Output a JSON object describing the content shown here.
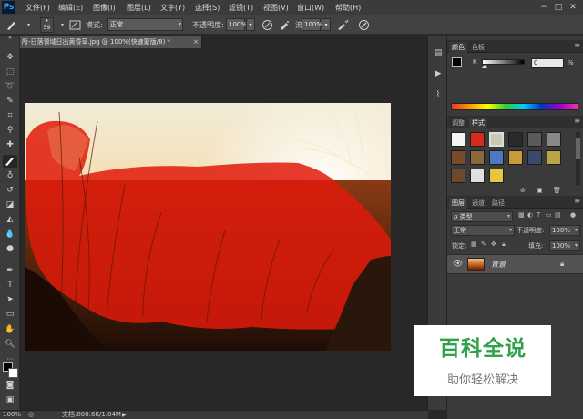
{
  "app": {
    "logo": "Ps"
  },
  "menu": {
    "items": [
      "文件(F)",
      "编辑(E)",
      "图像(I)",
      "图层(L)",
      "文字(Y)",
      "选择(S)",
      "滤镜(T)",
      "视图(V)",
      "窗口(W)",
      "帮助(H)"
    ]
  },
  "window_controls": {
    "minimize": "−",
    "maximize": "□",
    "close": "✕"
  },
  "options_bar": {
    "brush_size": "59",
    "mode_label": "模式:",
    "mode_value": "正常",
    "opacity_label": "不透明度:",
    "opacity_value": "100%",
    "flow_label": "流量:",
    "flow_value": "100%"
  },
  "document": {
    "tab_title": "所-日落领域日出黄昏草.jpg @ 100%(快速蒙版/8) *",
    "tab_close": "×"
  },
  "status": {
    "zoom": "100%",
    "doc_size": "文档:800.6K/1.04M"
  },
  "color_panel": {
    "tabs": [
      "颜色",
      "色板"
    ],
    "slider_label": "K",
    "value": "0",
    "unit": "%"
  },
  "styles_panel": {
    "tabs": [
      "调整",
      "样式"
    ],
    "swatch_colors": [
      "#f4f4f4",
      "#d92b1c",
      "#c9c9b2",
      "#2a2a2a",
      "#5a5a5a",
      "#888888",
      "#7a4a2a",
      "#8a6a3a",
      "#4a7ac0",
      "#c99a3a",
      "#3a4a6a",
      "#b9a44a",
      "#6a4a2a",
      "#e0e0e0",
      "#e6c640"
    ]
  },
  "layers_panel": {
    "tabs": [
      "图层",
      "通道",
      "路径"
    ],
    "filter_label": "ρ 类型",
    "blend_mode": "正常",
    "opacity_label": "不透明度:",
    "opacity_value": "100%",
    "lock_label": "锁定:",
    "fill_label": "填充:",
    "fill_value": "100%",
    "layers": [
      {
        "name": "背景"
      }
    ]
  },
  "watermark": {
    "title": "百科全说",
    "subtitle": "助你轻松解决"
  }
}
